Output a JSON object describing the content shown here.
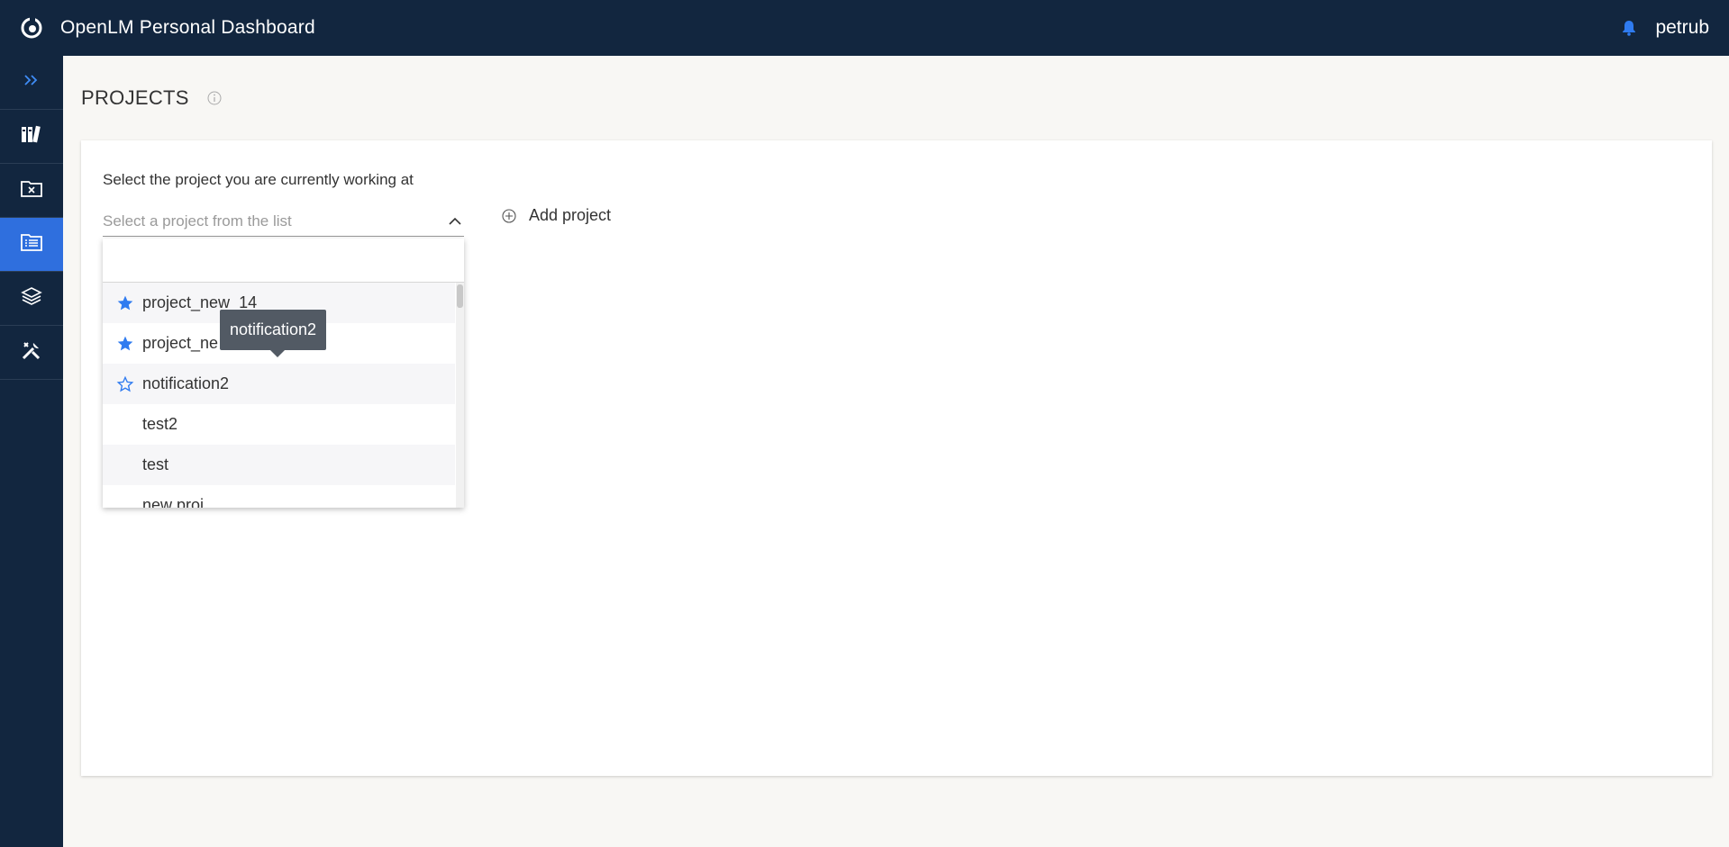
{
  "header": {
    "app_title": "OpenLM Personal Dashboard",
    "username": "petrub",
    "bell_color": "#2f7bf0"
  },
  "sidebar": {
    "items": [
      {
        "icon": "expand-chevrons-icon"
      },
      {
        "icon": "library-icon"
      },
      {
        "icon": "folder-x-icon"
      },
      {
        "icon": "projects-list-icon",
        "active": true
      },
      {
        "icon": "layers-icon"
      },
      {
        "icon": "tools-icon"
      }
    ]
  },
  "page": {
    "title": "PROJECTS"
  },
  "card": {
    "label": "Select the project you are currently working at",
    "select_placeholder": "Select a project from the list",
    "add_project_label": "Add project"
  },
  "dropdown": {
    "search_value": "",
    "items": [
      {
        "label": "project_new_14",
        "star": "filled"
      },
      {
        "label": "project_ne",
        "star": "filled"
      },
      {
        "label": "notification2",
        "star": "outline"
      },
      {
        "label": "test2",
        "star": "none"
      },
      {
        "label": "test",
        "star": "none"
      },
      {
        "label": "new proj",
        "star": "none"
      }
    ]
  },
  "tooltip": {
    "text": "notification2"
  },
  "colors": {
    "nav_bg": "#12263f",
    "accent": "#2f6fde",
    "star": "#2f7bf0"
  }
}
